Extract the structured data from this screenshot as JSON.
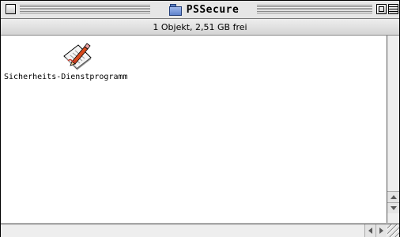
{
  "window": {
    "title": "PSSecure",
    "title_icon": "folder-icon",
    "status_text": "1 Objekt, 2,51 GB frei"
  },
  "items": [
    {
      "label": "Sicherheits-Dienstprogramm",
      "icon": "document-pencil-icon"
    }
  ],
  "colors": {
    "folder_blue": "#5f83cc",
    "window_gray": "#dddddd",
    "content_bg": "#ffffff"
  }
}
